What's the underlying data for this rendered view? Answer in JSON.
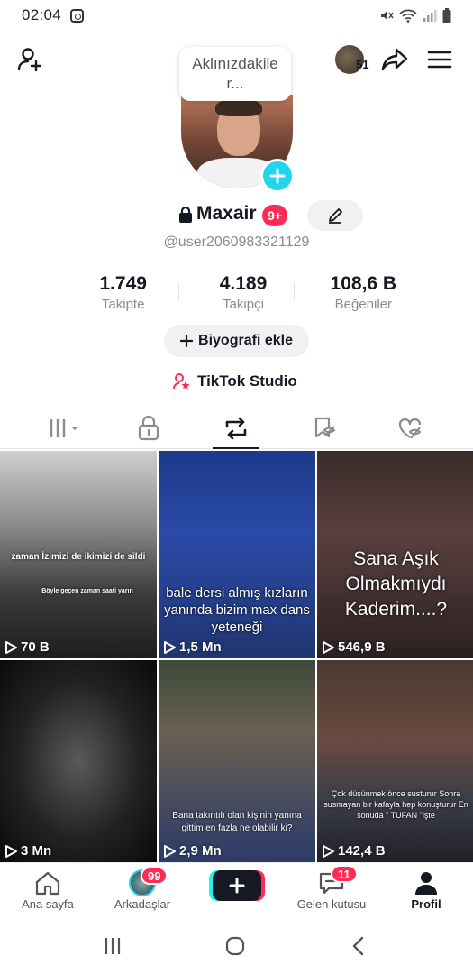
{
  "status_bar": {
    "time": "02:04"
  },
  "header": {
    "following_avatar_count": "51",
    "bubble_text": "Aklınızdakile r..."
  },
  "profile": {
    "username": "Maxair",
    "notification_badge": "9+",
    "handle": "@user2060983321129",
    "stats": [
      {
        "value": "1.749",
        "label": "Takipte"
      },
      {
        "value": "4.189",
        "label": "Takipçi"
      },
      {
        "value": "108,6 B",
        "label": "Beğeniler"
      }
    ],
    "bio_button": "Biyografi ekle",
    "studio_link": "TikTok Studio"
  },
  "videos": [
    {
      "views": "70 B",
      "caption": "zaman İzimizi de ikimizi de sildi",
      "caption2": "Böyle geçen zaman saati yarın"
    },
    {
      "views": "1,5 Mn",
      "caption": "bale dersi almış kızların yanında bizim max dans yeteneği"
    },
    {
      "views": "546,9 B",
      "caption": "Sana Aşık Olmakmıydı Kaderim....?"
    },
    {
      "views": "3 Mn"
    },
    {
      "views": "2,9 Mn",
      "caption": "Bana takıntılı olan kişinin yanına gittim en fazla ne olabilir ki?"
    },
    {
      "views": "142,4 B",
      "caption": "Çok düşünmek önce susturur Sonra susmayan bir kafayla hep konuşturur En sonuda \" TUFAN \"işte"
    }
  ],
  "bottom_nav": {
    "home": "Ana sayfa",
    "friends": "Arkadaşlar",
    "friends_badge": "99",
    "inbox": "Gelen kutusu",
    "inbox_badge": "11",
    "profile": "Profil"
  },
  "colors": {
    "accent_red": "#fe2c55",
    "accent_cyan": "#20d5ec",
    "text_dark": "#161823",
    "text_gray": "#8a8b91"
  }
}
